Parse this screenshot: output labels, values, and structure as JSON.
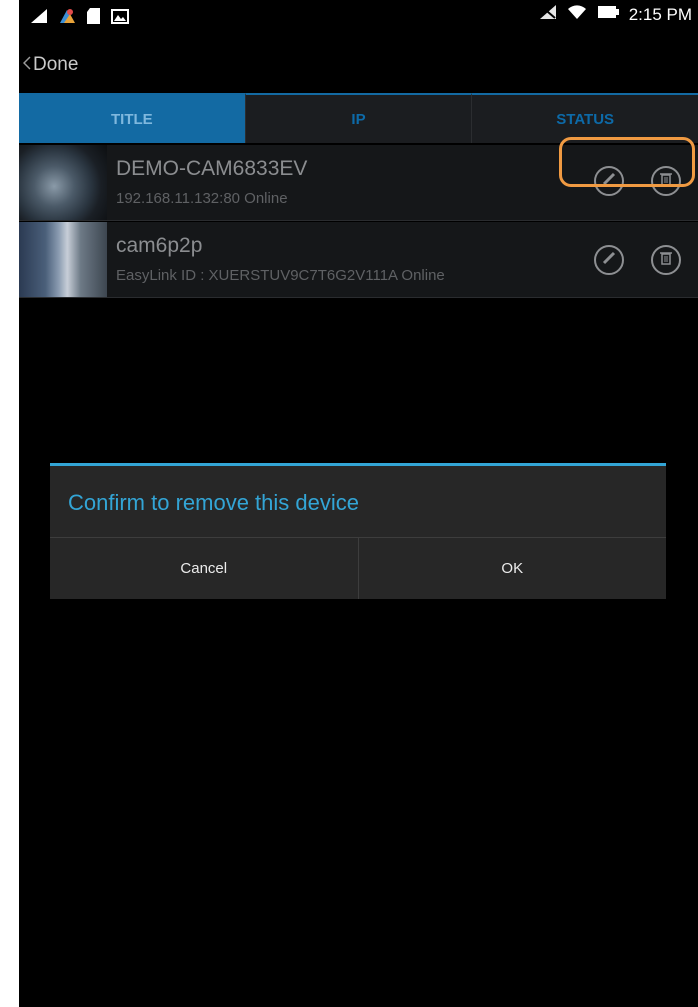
{
  "status_bar": {
    "time": "2:15 PM",
    "left_icons": [
      "signal-icon",
      "camera-app-icon",
      "sd-card-icon",
      "gallery-icon"
    ],
    "right_icons": [
      "no-signal-icon",
      "wifi-icon",
      "battery-icon"
    ]
  },
  "nav": {
    "back_label": "Done"
  },
  "tabs": [
    {
      "label": "TITLE",
      "active": true
    },
    {
      "label": "IP",
      "active": false
    },
    {
      "label": "STATUS",
      "active": false
    }
  ],
  "devices": [
    {
      "name": "DEMO-CAM6833EV",
      "subtitle": "192.168.11.132:80 Online"
    },
    {
      "name": "cam6p2p",
      "subtitle": "EasyLink ID : XUERSTUV9C7T6G2V111A Online"
    }
  ],
  "dialog": {
    "message": "Confirm to remove this device",
    "cancel_label": "Cancel",
    "ok_label": "OK"
  },
  "colors": {
    "accent": "#33a5d6",
    "tab_active": "#136aa3",
    "highlight": "#f09a42"
  }
}
